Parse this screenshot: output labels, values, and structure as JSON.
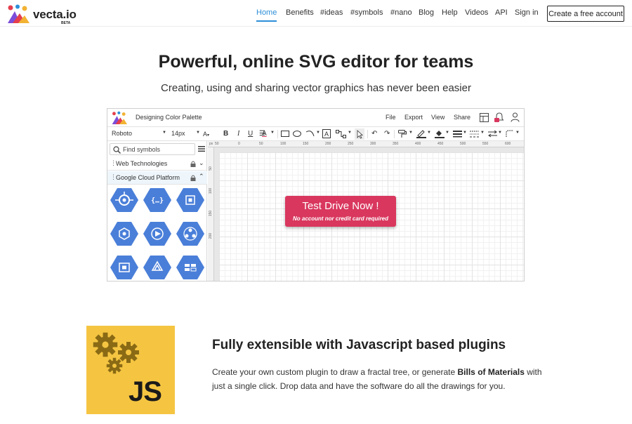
{
  "brand": {
    "name": "vecta.io",
    "badge": "BETA"
  },
  "nav": {
    "links": [
      "Home",
      "Benefits",
      "#ideas",
      "#symbols",
      "#nano",
      "Blog",
      "Help",
      "Videos",
      "API",
      "Sign in"
    ],
    "active": "Home",
    "cta_label": "Create a free account"
  },
  "hero": {
    "title": "Powerful, online SVG editor for teams",
    "subtitle": "Creating, using and sharing vector graphics has never been easier"
  },
  "editor": {
    "document_title": "Designing Color Palette",
    "menu": [
      "File",
      "Export",
      "View",
      "Share"
    ],
    "toolbar": {
      "font_family": "Roboto",
      "font_size": "14px"
    },
    "sidebar": {
      "search_placeholder": "Find symbols",
      "categories": [
        {
          "label": "Web Technologies",
          "expanded": false
        },
        {
          "label": "Google Cloud Platform",
          "expanded": true
        }
      ],
      "symbols": [
        "compute-engine-icon",
        "cloud-endpoints-icon",
        "cloud-tpu-icon",
        "cloud-functions-icon",
        "app-engine-icon",
        "cloud-ml-icon",
        "gpu-icon",
        "cloud-dataflow-icon",
        "container-builder-icon"
      ]
    },
    "ruler": {
      "unit": "px",
      "top_ticks": [
        "50",
        "0",
        "50",
        "100",
        "150",
        "200",
        "250",
        "300",
        "350",
        "400",
        "450",
        "500",
        "550",
        "600"
      ],
      "left_ticks": [
        "50",
        "100",
        "150",
        "200"
      ]
    },
    "cta": {
      "title": "Test Drive Now !",
      "subtitle": "No account nor credit card required"
    }
  },
  "feature": {
    "tile_label": "JS",
    "title": "Fully extensible with Javascript based plugins",
    "body_part1": "Create your own custom plugin to draw a fractal tree, or generate ",
    "body_bold": "Bills of Materials",
    "body_part2": " with just a single click. Drop data and have the software do all the drawings for you."
  },
  "colors": {
    "accent": "#2d8fd8",
    "cta_red": "#d9375e",
    "hex_blue": "#4a7fd9",
    "js_yellow": "#f5c542",
    "gear_brown": "#8a6a14"
  }
}
